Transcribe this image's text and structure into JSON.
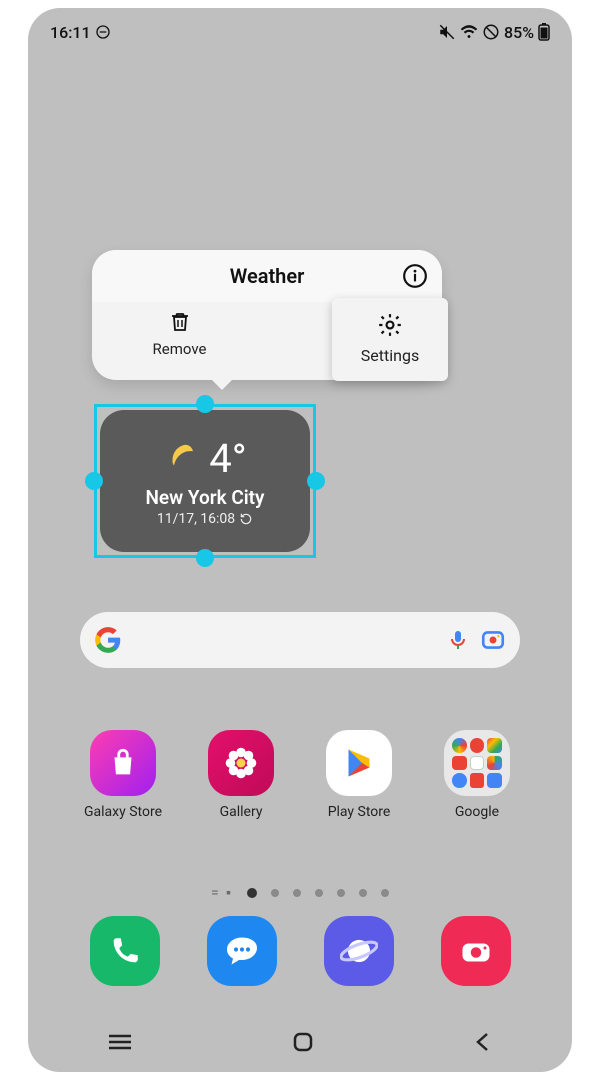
{
  "status": {
    "time": "16:11",
    "battery": "85%"
  },
  "popup": {
    "title": "Weather",
    "remove": "Remove",
    "settings": "Settings"
  },
  "weather": {
    "temp": "4°",
    "city": "New York City",
    "updated": "11/17, 16:08"
  },
  "apps": {
    "galaxy": "Galaxy Store",
    "gallery": "Gallery",
    "play": "Play Store",
    "google": "Google"
  }
}
